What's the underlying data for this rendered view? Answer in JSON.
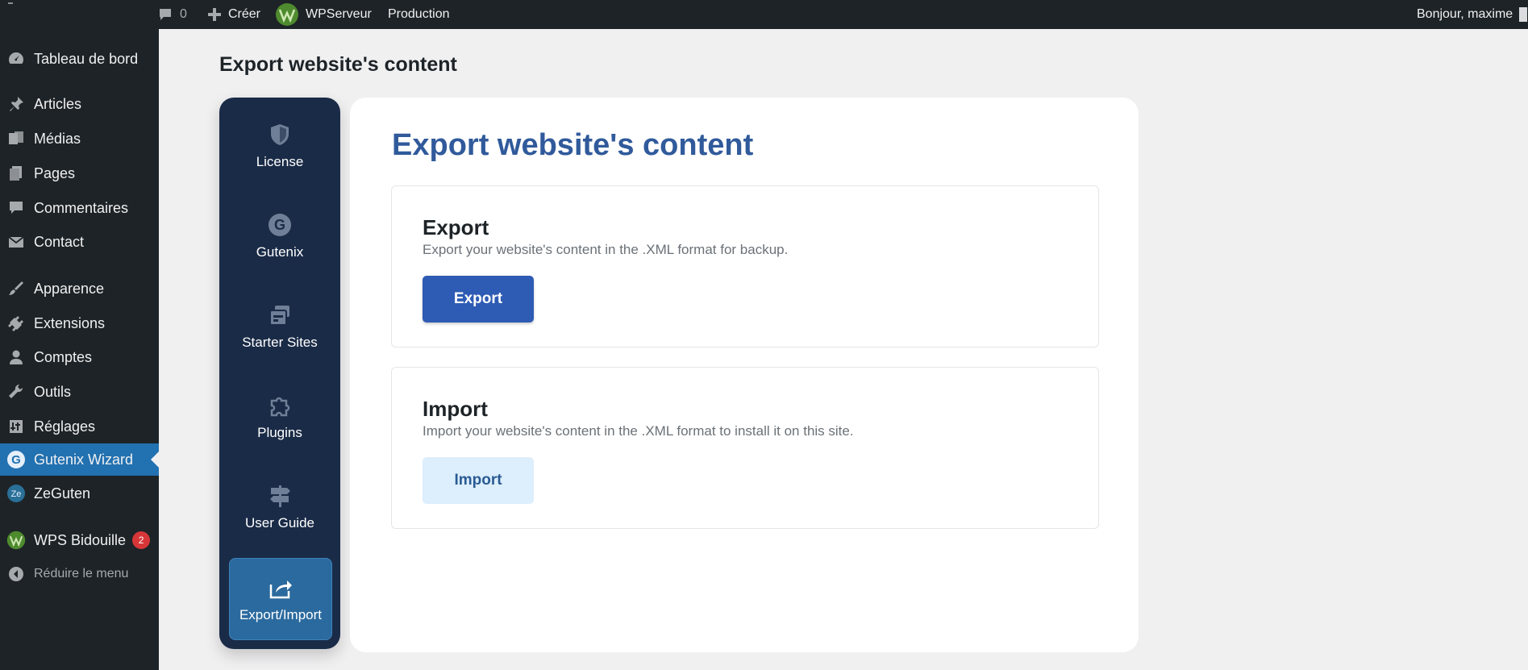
{
  "adminbar": {
    "comments_count": "0",
    "create_label": "Créer",
    "site_label": "WPServeur",
    "env_label": "Production",
    "greeting": "Bonjour, maxime"
  },
  "admin_menu": {
    "items": [
      {
        "label": "Tableau de bord",
        "icon": "dashboard-icon"
      },
      {
        "label": "Articles",
        "icon": "pin-icon"
      },
      {
        "label": "Médias",
        "icon": "media-icon"
      },
      {
        "label": "Pages",
        "icon": "pages-icon"
      },
      {
        "label": "Commentaires",
        "icon": "comment-icon"
      },
      {
        "label": "Contact",
        "icon": "mail-icon"
      },
      {
        "label": "Apparence",
        "icon": "brush-icon"
      },
      {
        "label": "Extensions",
        "icon": "plugin-icon"
      },
      {
        "label": "Comptes",
        "icon": "user-icon"
      },
      {
        "label": "Outils",
        "icon": "wrench-icon"
      },
      {
        "label": "Réglages",
        "icon": "settings-icon"
      },
      {
        "label": "Gutenix Wizard",
        "icon": "gutenix-g-icon",
        "active": true
      },
      {
        "label": "ZeGuten",
        "icon": "zeguten-icon"
      },
      {
        "label": "WPS Bidouille",
        "icon": "wps-logo-icon",
        "badge": "2"
      }
    ],
    "collapse_label": "Réduire le menu"
  },
  "page": {
    "heading": "Export website's content"
  },
  "wizard_nav": {
    "items": [
      {
        "label": "License",
        "icon": "shield-icon"
      },
      {
        "label": "Gutenix",
        "icon": "gutenix-g-icon"
      },
      {
        "label": "Starter Sites",
        "icon": "layout-icon"
      },
      {
        "label": "Plugins",
        "icon": "puzzle-icon"
      },
      {
        "label": "User Guide",
        "icon": "signpost-icon"
      },
      {
        "label": "Export/Import",
        "icon": "share-arrow-icon",
        "active": true
      }
    ]
  },
  "panel": {
    "title": "Export website's content",
    "export": {
      "title": "Export",
      "description": "Export your website's content in the .XML format for backup.",
      "button": "Export"
    },
    "import": {
      "title": "Import",
      "description": "Import your website's content in the .XML format to install it on this site.",
      "button": "Import"
    }
  },
  "colors": {
    "admin_dark": "#1d2327",
    "admin_active": "#2271b1",
    "wizard_nav_bg": "#1a2b47",
    "panel_title": "#305a9b",
    "primary_button": "#2e5bb3",
    "secondary_button": "#ddeefc"
  }
}
